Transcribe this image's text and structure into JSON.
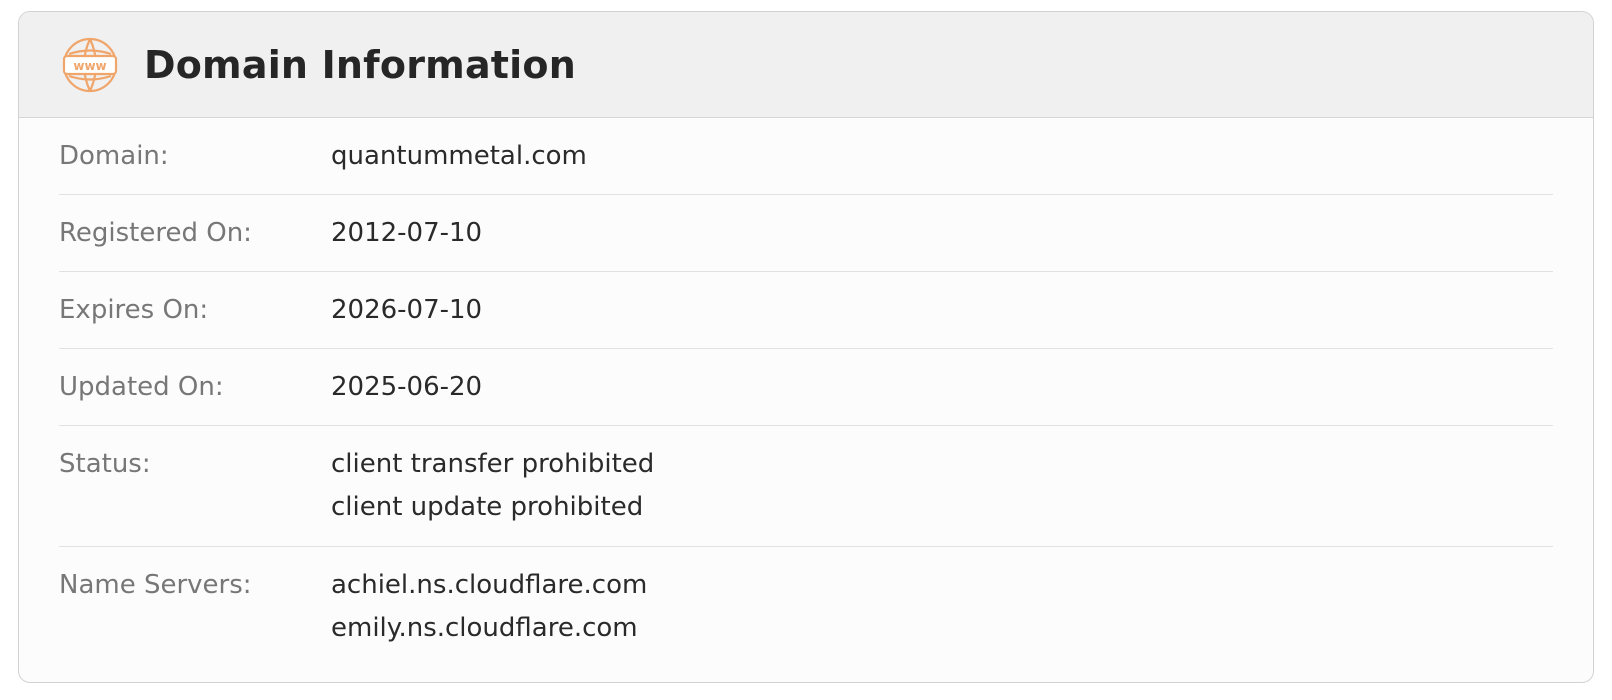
{
  "panel": {
    "title": "Domain Information",
    "icon": "www-globe-icon",
    "accent_color": "#f0a56a"
  },
  "rows": [
    {
      "label": "Domain:",
      "values": [
        "quantummetal.com"
      ]
    },
    {
      "label": "Registered On:",
      "values": [
        "2012-07-10"
      ]
    },
    {
      "label": "Expires On:",
      "values": [
        "2026-07-10"
      ]
    },
    {
      "label": "Updated On:",
      "values": [
        "2025-06-20"
      ]
    },
    {
      "label": "Status:",
      "values": [
        "client transfer prohibited",
        "client update prohibited"
      ]
    },
    {
      "label": "Name Servers:",
      "values": [
        "achiel.ns.cloudflare.com",
        "emily.ns.cloudflare.com"
      ]
    }
  ]
}
